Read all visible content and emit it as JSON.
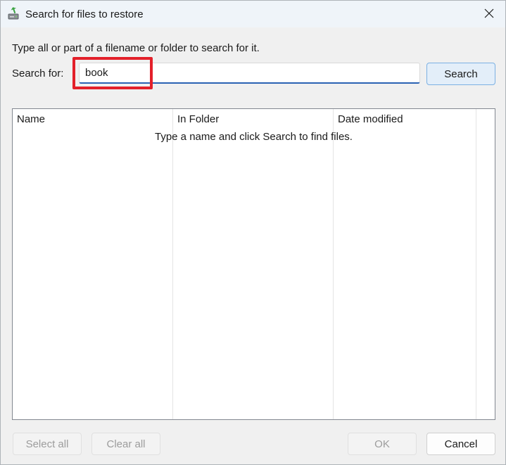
{
  "window": {
    "title": "Search for files to restore",
    "icon": "restore-drive-icon",
    "close_icon": "close-icon"
  },
  "instruction": "Type all or part of a filename or folder to search for it.",
  "search": {
    "label": "Search for:",
    "value": "book",
    "button_label": "Search"
  },
  "results": {
    "columns": [
      "Name",
      "In Folder",
      "Date modified"
    ],
    "empty_message": "Type a name and click Search to find files."
  },
  "footer": {
    "select_all_label": "Select all",
    "clear_all_label": "Clear all",
    "ok_label": "OK",
    "cancel_label": "Cancel"
  },
  "colors": {
    "highlight": "#e3202a",
    "input_focus": "#2a62b3",
    "search_button_border": "#7bb0e3"
  }
}
